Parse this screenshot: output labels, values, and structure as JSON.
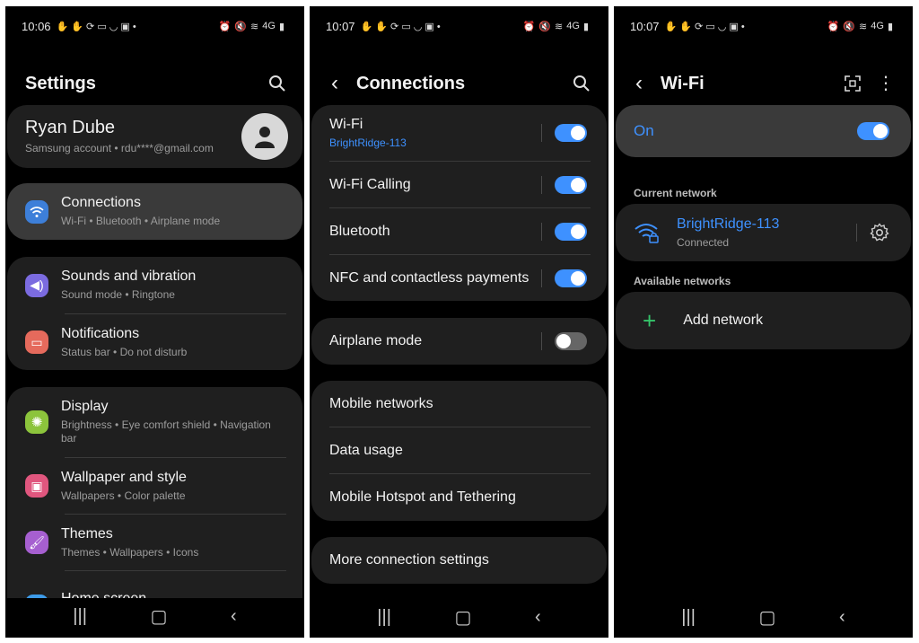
{
  "panel1": {
    "status": {
      "time": "10:06",
      "signal": "4G"
    },
    "title": "Settings",
    "account": {
      "name": "Ryan Dube",
      "sub": "Samsung account  •  rdu****@gmail.com"
    },
    "items": [
      {
        "label": "Connections",
        "sub": "Wi-Fi  •  Bluetooth  •  Airplane mode",
        "icon": "wifi-icon",
        "color": "#3d7fd9"
      },
      {
        "label": "Sounds and vibration",
        "sub": "Sound mode  •  Ringtone",
        "icon": "volume-icon",
        "color": "#7b6be0"
      },
      {
        "label": "Notifications",
        "sub": "Status bar  •  Do not disturb",
        "icon": "notification-icon",
        "color": "#e56a5c"
      },
      {
        "label": "Display",
        "sub": "Brightness  •  Eye comfort shield  •  Navigation bar",
        "icon": "sun-icon",
        "color": "#8cc43c"
      },
      {
        "label": "Wallpaper and style",
        "sub": "Wallpapers  •  Color palette",
        "icon": "wallpaper-icon",
        "color": "#e0567e"
      },
      {
        "label": "Themes",
        "sub": "Themes  •  Wallpapers  •  Icons",
        "icon": "themes-icon",
        "color": "#a65fd0"
      },
      {
        "label": "Home screen",
        "icon": "home-icon",
        "color": "#3d9be9"
      }
    ]
  },
  "panel2": {
    "status": {
      "time": "10:07",
      "signal": "4G"
    },
    "title": "Connections",
    "wifi": {
      "label": "Wi-Fi",
      "sub": "BrightRidge-113",
      "on": true
    },
    "wifi_calling": {
      "label": "Wi-Fi Calling",
      "on": true
    },
    "bluetooth": {
      "label": "Bluetooth",
      "on": true
    },
    "nfc": {
      "label": "NFC and contactless payments",
      "on": true
    },
    "airplane": {
      "label": "Airplane mode",
      "on": false
    },
    "mobile_networks": "Mobile networks",
    "data_usage": "Data usage",
    "hotspot": "Mobile Hotspot and Tethering",
    "more": "More connection settings"
  },
  "panel3": {
    "status": {
      "time": "10:07",
      "signal": "4G"
    },
    "title": "Wi-Fi",
    "master": {
      "label": "On",
      "on": true
    },
    "current_label": "Current network",
    "current": {
      "name": "BrightRidge-113",
      "status": "Connected"
    },
    "available_label": "Available networks",
    "add": "Add network"
  },
  "colors": {
    "accent": "#3e91ff",
    "card": "#1f1f1f",
    "add_green": "#35c46a"
  }
}
